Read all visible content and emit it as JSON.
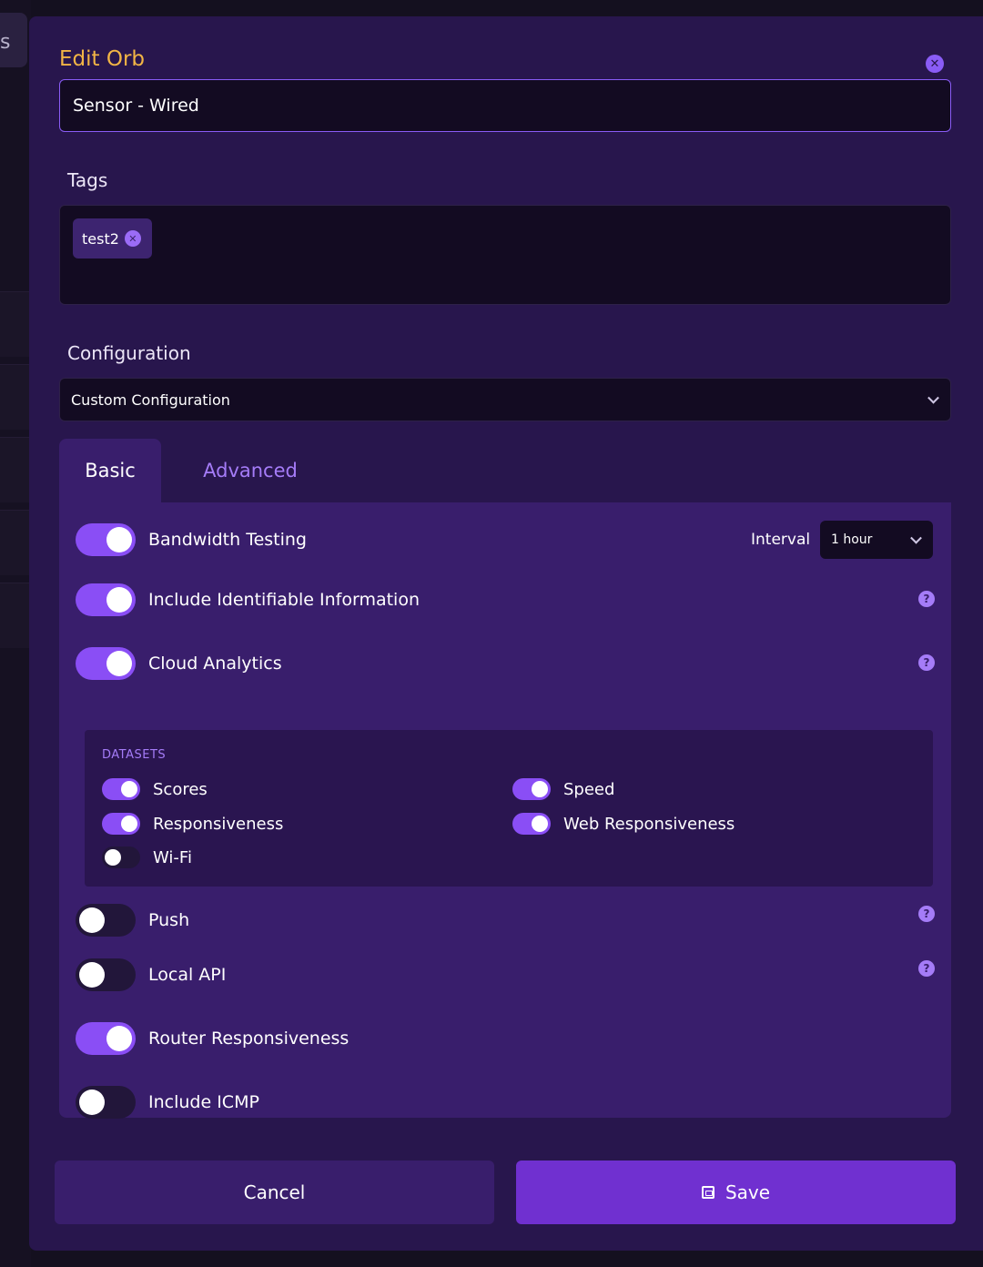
{
  "background": {
    "tab_stub_text": "s"
  },
  "modal": {
    "title": "Edit Orb",
    "name_value": "Sensor - Wired",
    "tags_label": "Tags",
    "tags": [
      {
        "label": "test2"
      }
    ],
    "configuration_label": "Configuration",
    "configuration_value": "Custom Configuration",
    "tabs": [
      {
        "label": "Basic",
        "active": true
      },
      {
        "label": "Advanced",
        "active": false
      }
    ],
    "settings": {
      "bandwidth_testing": {
        "label": "Bandwidth Testing",
        "on": true,
        "interval_label": "Interval",
        "interval_value": "1 hour"
      },
      "identifiable_info": {
        "label": "Include Identifiable Information",
        "on": true
      },
      "cloud_analytics": {
        "label": "Cloud Analytics",
        "on": true
      },
      "push": {
        "label": "Push",
        "on": false
      },
      "local_api": {
        "label": "Local API",
        "on": false
      },
      "router_responsiveness": {
        "label": "Router Responsiveness",
        "on": true
      },
      "include_icmp": {
        "label": "Include ICMP",
        "on": false
      }
    },
    "datasets": {
      "title": "DATASETS",
      "items": [
        {
          "label": "Scores",
          "on": true
        },
        {
          "label": "Speed",
          "on": true
        },
        {
          "label": "Responsiveness",
          "on": true
        },
        {
          "label": "Web Responsiveness",
          "on": true
        },
        {
          "label": "Wi-Fi",
          "on": false
        }
      ]
    },
    "buttons": {
      "cancel": "Cancel",
      "save": "Save"
    }
  },
  "icons": {
    "close": "close-circle-icon",
    "help": "question-circle-icon",
    "chevron": "chevron-down-icon",
    "save": "floppy-disk-icon"
  },
  "colors": {
    "accent": "#8a4ef5",
    "title": "#f2b545",
    "modal_bg": "#28164d",
    "panel_bg": "#391e6c"
  }
}
